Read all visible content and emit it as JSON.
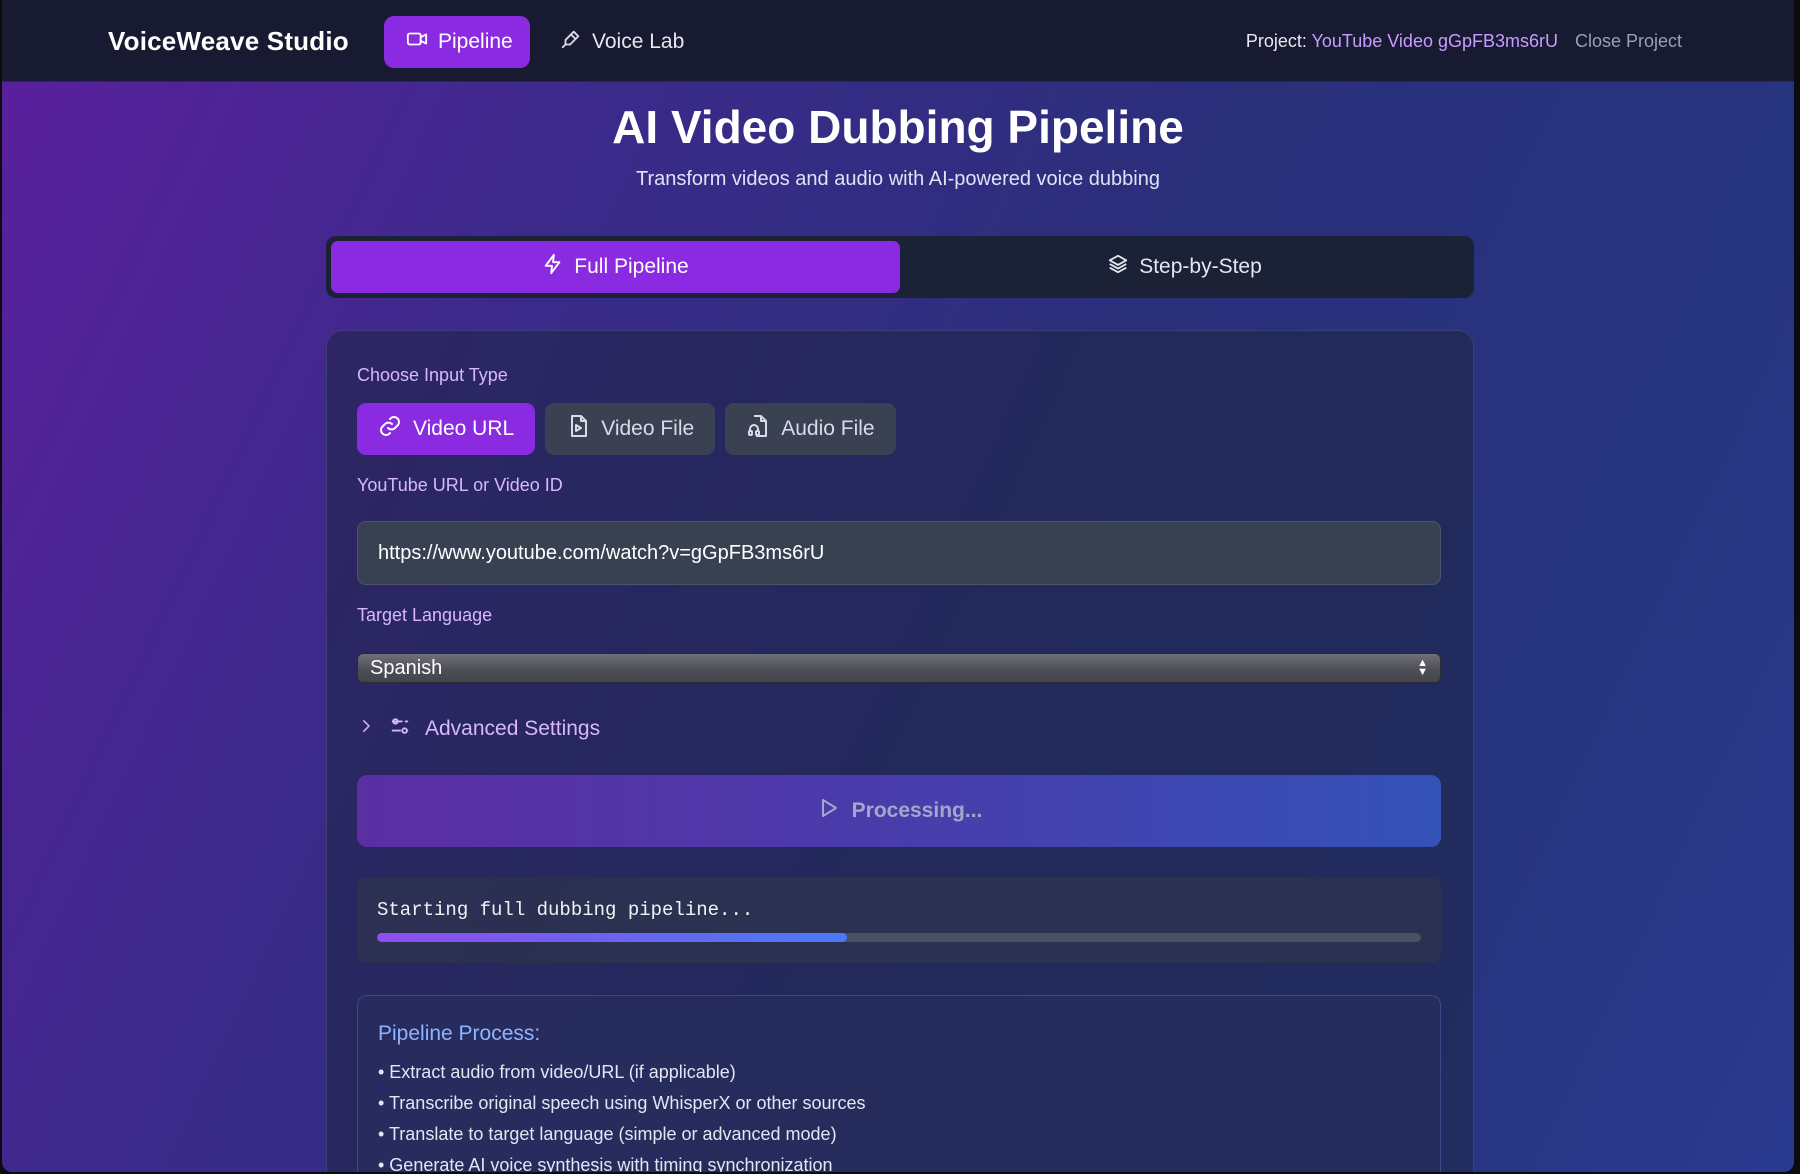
{
  "header": {
    "brand": "VoiceWeave Studio",
    "nav": [
      {
        "label": "Pipeline",
        "icon": "video-camera-icon",
        "active": true
      },
      {
        "label": "Voice Lab",
        "icon": "pen-icon",
        "active": false
      }
    ],
    "project_prefix": "Project: ",
    "project_name": "YouTube Video gGpFB3ms6rU",
    "close_label": "Close Project"
  },
  "hero": {
    "title": "AI Video Dubbing Pipeline",
    "subtitle": "Transform videos and audio with AI-powered voice dubbing"
  },
  "mode_tabs": [
    {
      "label": "Full Pipeline",
      "icon": "lightning-icon",
      "active": true
    },
    {
      "label": "Step-by-Step",
      "icon": "layers-icon",
      "active": false
    }
  ],
  "form": {
    "input_type_label": "Choose Input Type",
    "input_types": [
      {
        "label": "Video URL",
        "icon": "link-icon",
        "active": true
      },
      {
        "label": "Video File",
        "icon": "video-file-icon",
        "active": false
      },
      {
        "label": "Audio File",
        "icon": "audio-file-icon",
        "active": false
      }
    ],
    "url_label": "YouTube URL or Video ID",
    "url_value": "https://www.youtube.com/watch?v=gGpFB3ms6rU",
    "language_label": "Target Language",
    "language_value": "Spanish",
    "advanced_label": "Advanced Settings",
    "process_label": "Processing..."
  },
  "status": {
    "message": "Starting full dubbing pipeline...",
    "progress_fraction": 0.45
  },
  "pipeline_process": {
    "title": "Pipeline Process:",
    "steps": [
      "• Extract audio from video/URL (if applicable)",
      "• Transcribe original speech using WhisperX or other sources",
      "• Translate to target language (simple or advanced mode)",
      "• Generate AI voice synthesis with timing synchronization"
    ]
  },
  "colors": {
    "accent": "#8a2be2",
    "project_name": "#c79cff",
    "label": "#d8b7ff",
    "info_title": "#8fb4ff"
  }
}
